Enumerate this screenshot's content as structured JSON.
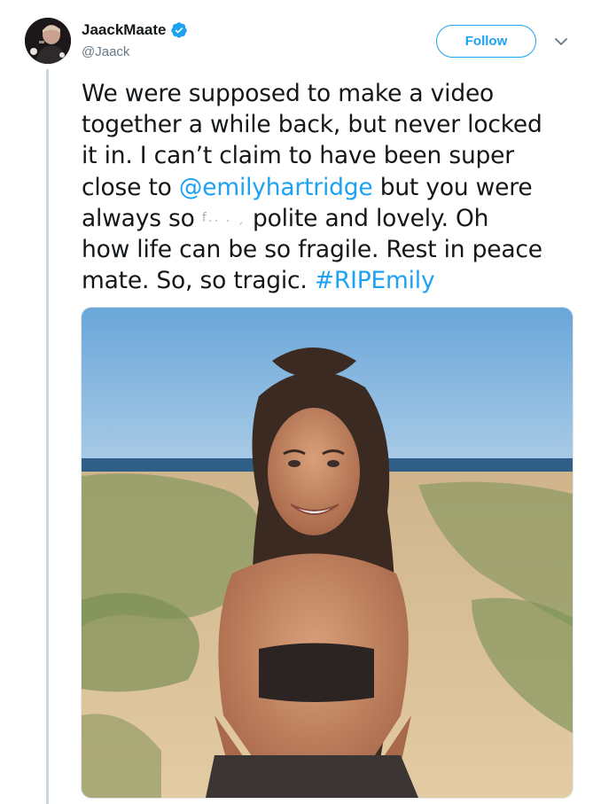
{
  "author": {
    "display_name": "JaackMaate",
    "handle": "@Jaack",
    "verified": true
  },
  "actions": {
    "follow_label": "Follow",
    "menu_icon": "chevron-down-icon"
  },
  "tweet": {
    "line1": "We were supposed to make a video",
    "line2": "together a while back, but never locked",
    "line3": "it in. I can’t claim to have been super",
    "line4_pre": "close to ",
    "line4_mention": "@emilyhartridge",
    "line4_post": " but you were",
    "line5_pre": "always so ",
    "line5_redacted": "f․․ ․ ˏ",
    "line5_post": " polite and lovely. Oh",
    "line6": "how life can be so fragile. Rest in peace",
    "line7_pre": "mate. So, so tragic. ",
    "line7_hashtag": "#RIPEmily"
  },
  "colors": {
    "link": "#1da1f2",
    "text": "#14171a",
    "secondary": "#657786",
    "thread_line": "#ccd6dd"
  },
  "media": {
    "kind": "photo",
    "icon": "photo-icon"
  }
}
